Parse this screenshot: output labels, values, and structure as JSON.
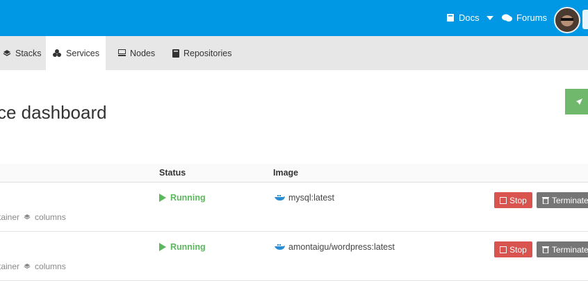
{
  "header": {
    "docs_label": "Docs",
    "forums_label": "Forums",
    "colors": {
      "bar": "#0098e5"
    }
  },
  "tabs": [
    {
      "label": "Stacks",
      "icon": "stack-icon"
    },
    {
      "label": "Services",
      "icon": "services-icon",
      "active": true
    },
    {
      "label": "Nodes",
      "icon": "server-icon"
    },
    {
      "label": "Repositories",
      "icon": "book-icon"
    }
  ],
  "page": {
    "title": "ce dashboard"
  },
  "table": {
    "headers": {
      "status": "Status",
      "image": "Image"
    },
    "rows": [
      {
        "status": "Running",
        "image": "mysql:latest",
        "meta_container": "tainer",
        "meta_stack": "columns",
        "stop": "Stop",
        "terminate": "Terminate"
      },
      {
        "status": "Running",
        "image": "amontaigu/wordpress:latest",
        "meta_container": "tainer",
        "meta_stack": "columns",
        "stop": "Stop",
        "terminate": "Terminate"
      }
    ]
  }
}
